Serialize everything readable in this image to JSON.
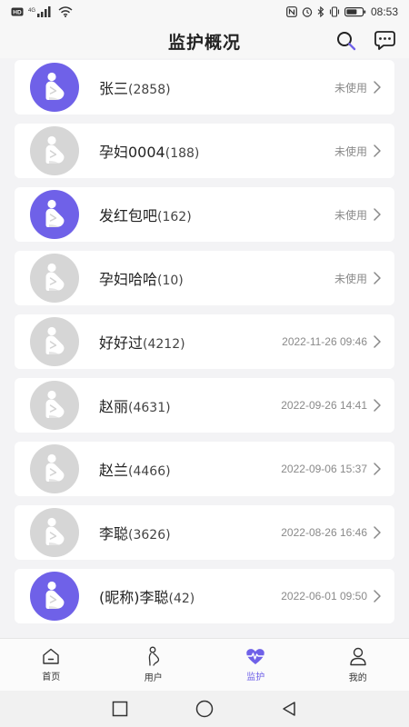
{
  "status_bar": {
    "left_icons": [
      "hd-icon",
      "signal-icon",
      "wifi-icon"
    ],
    "hd_text": "HD",
    "network_text": "4G",
    "time": "08:53",
    "right_icons": [
      "nfc-icon",
      "alarm-icon",
      "bluetooth-icon",
      "vibrate-icon",
      "battery-icon"
    ]
  },
  "header": {
    "title": "监护概况"
  },
  "users": [
    {
      "name": "张三",
      "id": "(2858)",
      "status": "未使用",
      "active": true
    },
    {
      "name": "孕妇0004",
      "id": "(188)",
      "status": "未使用",
      "active": false
    },
    {
      "name": "发红包吧",
      "id": "(162)",
      "status": "未使用",
      "active": true
    },
    {
      "name": "孕妇哈哈",
      "id": "(10)",
      "status": "未使用",
      "active": false
    },
    {
      "name": "好好过",
      "id": "(4212)",
      "status": "2022-11-26 09:46",
      "active": false
    },
    {
      "name": "赵丽",
      "id": "(4631)",
      "status": "2022-09-26 14:41",
      "active": false
    },
    {
      "name": "赵兰",
      "id": "(4466)",
      "status": "2022-09-06 15:37",
      "active": false
    },
    {
      "name": "李聪",
      "id": "(3626)",
      "status": "2022-08-26 16:46",
      "active": false
    },
    {
      "name": "(昵称)李聪",
      "id": "(42)",
      "status": "2022-06-01 09:50",
      "active": true
    }
  ],
  "tabs": [
    {
      "label": "首页",
      "icon": "home-icon",
      "active": false
    },
    {
      "label": "用户",
      "icon": "pregnant-user-icon",
      "active": false
    },
    {
      "label": "监护",
      "icon": "heart-monitor-icon",
      "active": true
    },
    {
      "label": "我的",
      "icon": "profile-icon",
      "active": false
    }
  ],
  "colors": {
    "accent": "#6f61e8",
    "inactive_avatar": "#d6d6d6",
    "background": "#f3f3f5"
  }
}
